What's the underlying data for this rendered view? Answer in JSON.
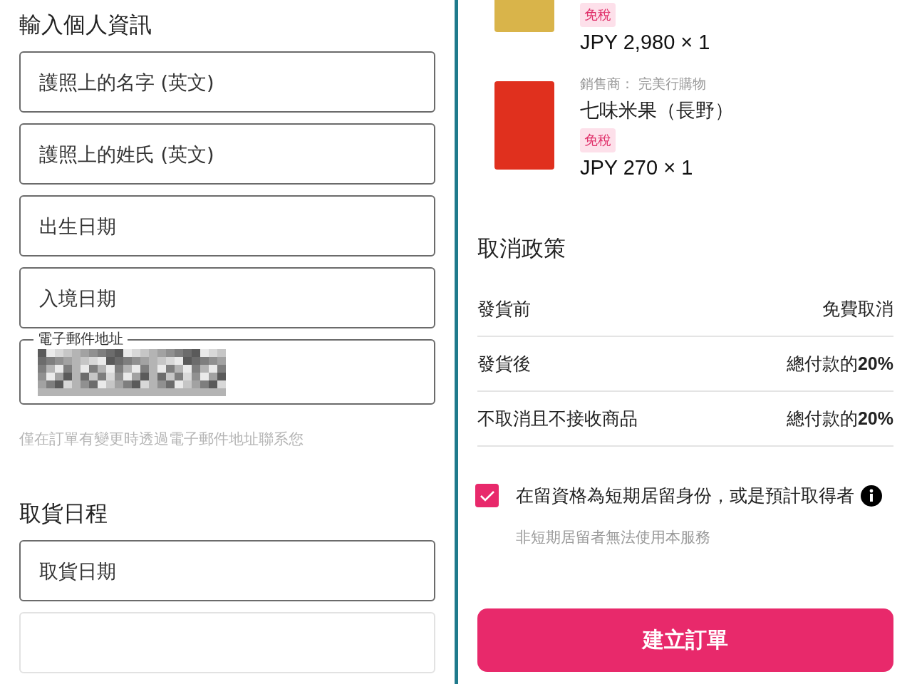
{
  "personal_info": {
    "heading": "輸入個人資訊",
    "fields": [
      {
        "placeholder": "護照上的名字 (英文)"
      },
      {
        "placeholder": "護照上的姓氏 (英文)"
      },
      {
        "placeholder": "出生日期"
      },
      {
        "placeholder": "入境日期"
      },
      {
        "label": "電子郵件地址",
        "redacted": true
      }
    ],
    "helper": "僅在訂單有變更時透過電子郵件地址聯系您"
  },
  "pickup": {
    "heading": "取貨日程",
    "fields": [
      {
        "placeholder": "取貨日期",
        "disabled": false
      },
      {
        "disabled": true
      }
    ]
  },
  "order_items": [
    {
      "tax_badge": "免稅",
      "price": "JPY 2,980 × 1"
    },
    {
      "seller": "銷售商： 完美行購物",
      "name": "七味米果（長野）",
      "tax_badge": "免稅",
      "price": "JPY 270 × 1"
    }
  ],
  "cancellation_policy": {
    "heading": "取消政策",
    "rows": [
      {
        "label": "發貨前",
        "value": "免費取消"
      },
      {
        "label": "發貨後",
        "value": "總付款的**20%**"
      },
      {
        "label": "不取消且不接收商品",
        "value": "總付款的**20%**"
      }
    ]
  },
  "residency_check": {
    "label": "在留資格為短期居留身份，或是預計取得者",
    "checked": true,
    "note": "非短期居留者無法使用本服務"
  },
  "submit_button": "建立訂單"
}
